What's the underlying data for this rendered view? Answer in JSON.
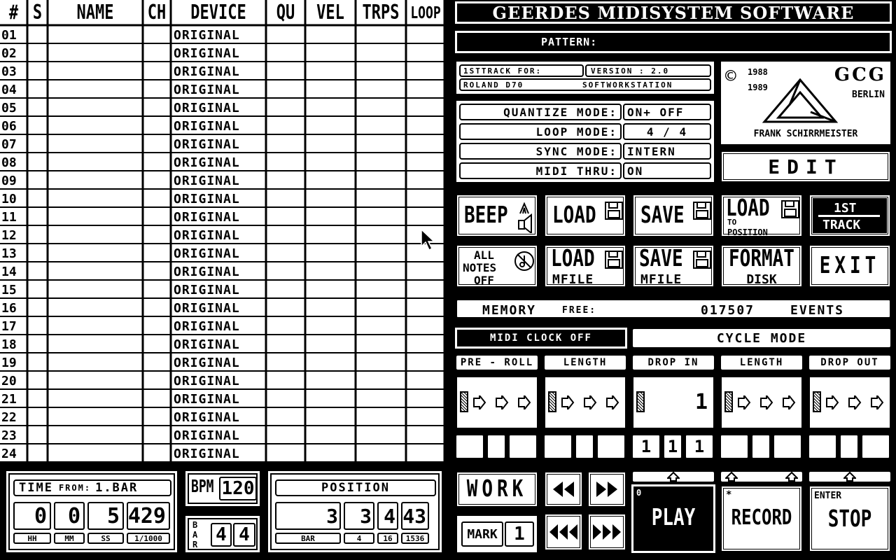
{
  "table": {
    "columns": [
      "#",
      "S",
      "NAME",
      "CH",
      "DEVICE",
      "QU",
      "VEL",
      "TRPS",
      "LOOP"
    ],
    "rows": [
      {
        "num": "01",
        "device": "ORIGINAL"
      },
      {
        "num": "02",
        "device": "ORIGINAL"
      },
      {
        "num": "03",
        "device": "ORIGINAL"
      },
      {
        "num": "04",
        "device": "ORIGINAL"
      },
      {
        "num": "05",
        "device": "ORIGINAL"
      },
      {
        "num": "06",
        "device": "ORIGINAL"
      },
      {
        "num": "07",
        "device": "ORIGINAL"
      },
      {
        "num": "08",
        "device": "ORIGINAL"
      },
      {
        "num": "09",
        "device": "ORIGINAL"
      },
      {
        "num": "10",
        "device": "ORIGINAL"
      },
      {
        "num": "11",
        "device": "ORIGINAL"
      },
      {
        "num": "12",
        "device": "ORIGINAL"
      },
      {
        "num": "13",
        "device": "ORIGINAL"
      },
      {
        "num": "14",
        "device": "ORIGINAL"
      },
      {
        "num": "15",
        "device": "ORIGINAL"
      },
      {
        "num": "16",
        "device": "ORIGINAL"
      },
      {
        "num": "17",
        "device": "ORIGINAL"
      },
      {
        "num": "18",
        "device": "ORIGINAL"
      },
      {
        "num": "19",
        "device": "ORIGINAL"
      },
      {
        "num": "20",
        "device": "ORIGINAL"
      },
      {
        "num": "21",
        "device": "ORIGINAL"
      },
      {
        "num": "22",
        "device": "ORIGINAL"
      },
      {
        "num": "23",
        "device": "ORIGINAL"
      },
      {
        "num": "24",
        "device": "ORIGINAL"
      }
    ]
  },
  "header": {
    "title": "GEERDES MIDISYSTEM SOFTWARE",
    "pattern_label": "PATTERN:"
  },
  "info": {
    "line1_a": "1STTRACK  FOR:",
    "line1_b": "VERSION : 2.0",
    "line2_a": "ROLAND D70",
    "line2_b": "SOFTWORKSTATION"
  },
  "modes": {
    "quantize_label": "QUANTIZE MODE:",
    "quantize_value": "ON+ OFF",
    "loop_label": "LOOP MODE:",
    "loop_value": "4 / 4",
    "sync_label": "SYNC MODE:",
    "sync_value": "INTERN",
    "thru_label": "MIDI THRU:",
    "thru_value": "ON"
  },
  "logo": {
    "copyright": "©",
    "year1": "1988",
    "year2": "1989",
    "brand": "GCG",
    "city": "BERLIN",
    "author": "FRANK SCHIRRMEISTER"
  },
  "edit_label": "EDIT",
  "buttons": {
    "beep": "BEEP",
    "load": "LOAD",
    "save": "SAVE",
    "load_pos_1": "LOAD",
    "load_pos_2": "TO",
    "load_pos_3": "POSITION",
    "first_track_1": "1ST",
    "first_track_2": "TRACK",
    "all_notes_1": "ALL",
    "all_notes_2": "NOTES",
    "all_notes_3": "OFF",
    "load_mfile_1": "LOAD",
    "load_mfile_2": "MFILE",
    "save_mfile_1": "SAVE",
    "save_mfile_2": "MFILE",
    "format_1": "FORMAT",
    "format_2": "DISK",
    "exit": "EXIT"
  },
  "memory": {
    "label": "MEMORY",
    "free_label": "FREE:",
    "value": "017507",
    "unit": "EVENTS"
  },
  "clock": {
    "midi_clock": "MIDI CLOCK OFF",
    "cycle_mode": "CYCLE MODE"
  },
  "cycle": {
    "headers": [
      "PRE - ROLL",
      "LENGTH",
      "DROP  IN",
      "LENGTH",
      "DROP  OUT"
    ],
    "drop_in_value": "1",
    "drop_in_cells": [
      "1",
      "1",
      "1"
    ]
  },
  "time": {
    "label": "TIME",
    "from_label": "FROM:",
    "from_value": "1.BAR",
    "values": [
      "0",
      "0",
      "5",
      "429"
    ],
    "units": [
      "HH",
      "MM",
      "SS",
      "1/1000"
    ]
  },
  "bpm": {
    "label": "BPM",
    "value": "120"
  },
  "bar": {
    "label": "BAR",
    "num": "4",
    "den": "4"
  },
  "position": {
    "label": "POSITION",
    "values": [
      "3",
      "3",
      "4",
      "43"
    ],
    "units": [
      "BAR",
      "4",
      "16",
      "1536"
    ]
  },
  "transport": {
    "work": "WORK",
    "mark": "MARK",
    "mark_value": "1",
    "play": "PLAY",
    "record": "RECORD",
    "record_key": "*",
    "stop": "STOP",
    "stop_key": "ENTER",
    "play_key": "0"
  }
}
